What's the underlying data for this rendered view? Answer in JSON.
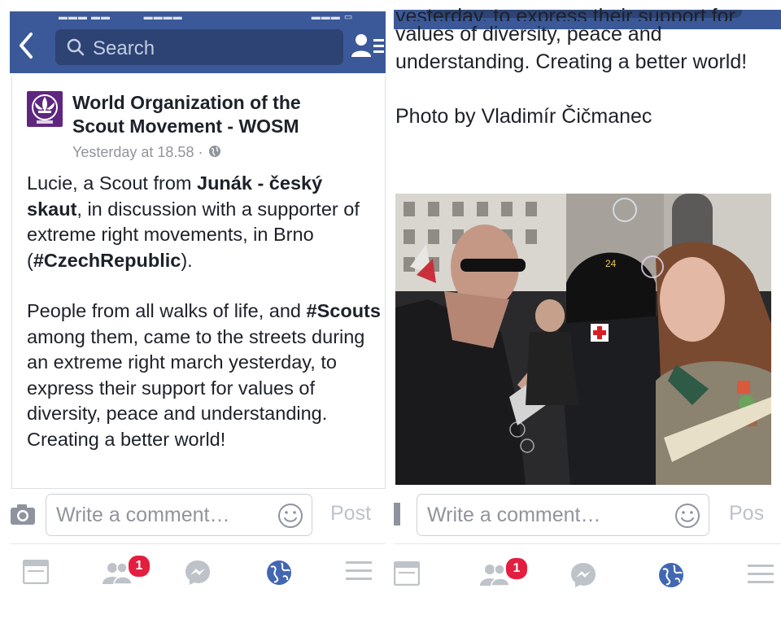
{
  "topbar": {
    "search_placeholder": "Search"
  },
  "post": {
    "page_name": "World Organization of the Scout Movement - WOSM",
    "timestamp": "Yesterday at 18.58",
    "separator": "·",
    "para1": {
      "t1": "Lucie, a Scout from ",
      "b1": "Junák - český skaut",
      "t2": ", in discussion with a supporter of extreme right movements, in Brno (",
      "b2": "#CzechRepublic",
      "t3": ")."
    },
    "para2": {
      "t1": "People from all walks of life, and ",
      "b1": "#Scouts",
      "t2": " among them, came to the streets during an extreme right march yesterday, to express their support for values of diversity, peace and understanding. Creating a better world!"
    }
  },
  "right_view": {
    "cut_line": "yesterday, to express their support for",
    "text": "values of diversity, peace and understanding. Creating a better world!",
    "photo_credit": "Photo by Vladimír Čičmanec"
  },
  "comment_bar": {
    "placeholder": "Write a comment…",
    "post_label": "Post",
    "post_label_cut": "Pos"
  },
  "tabbar": {
    "friends_badge": "1"
  },
  "colors": {
    "nav_blue": "#3b5998",
    "search_bg": "#2d4373",
    "badge_red": "#e41e3f",
    "wosm_purple": "#5f2680",
    "icon_gray": "#bec3c9",
    "globe_blue": "#4267b2"
  },
  "icons": [
    "back-chevron-icon",
    "search-icon",
    "friend-requests-icon",
    "wosm-logo",
    "globe-icon",
    "camera-icon",
    "emoji-icon",
    "news-feed-icon",
    "friends-icon",
    "messenger-icon",
    "notifications-globe-icon",
    "menu-icon"
  ]
}
